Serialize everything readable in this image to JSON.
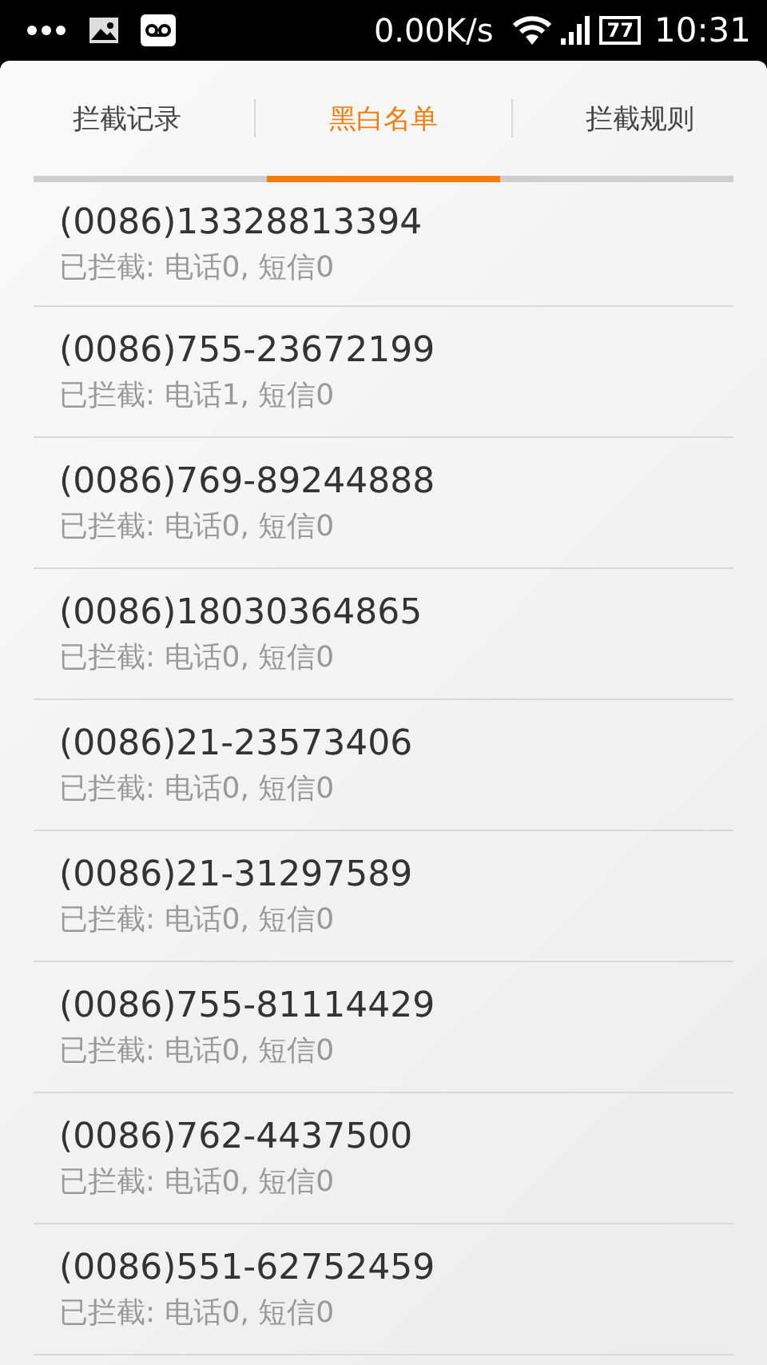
{
  "status_bar": {
    "net_speed": "0.00K/s",
    "battery": "77",
    "time": "10:31"
  },
  "tabs": [
    {
      "label": "拦截记录",
      "selected": false
    },
    {
      "label": "黑白名单",
      "selected": true
    },
    {
      "label": "拦截规则",
      "selected": false
    }
  ],
  "entries": [
    {
      "number": "(0086)13328813394",
      "summary": "已拦截: 电话0, 短信0"
    },
    {
      "number": "(0086)755-23672199",
      "summary": "已拦截: 电话1, 短信0"
    },
    {
      "number": "(0086)769-89244888",
      "summary": "已拦截: 电话0, 短信0"
    },
    {
      "number": "(0086)18030364865",
      "summary": "已拦截: 电话0, 短信0"
    },
    {
      "number": "(0086)21-23573406",
      "summary": "已拦截: 电话0, 短信0"
    },
    {
      "number": "(0086)21-31297589",
      "summary": "已拦截: 电话0, 短信0"
    },
    {
      "number": "(0086)755-81114429",
      "summary": "已拦截: 电话0, 短信0"
    },
    {
      "number": "(0086)762-4437500",
      "summary": "已拦截: 电话0, 短信0"
    },
    {
      "number": "(0086)551-62752459",
      "summary": "已拦截: 电话0, 短信0"
    }
  ]
}
